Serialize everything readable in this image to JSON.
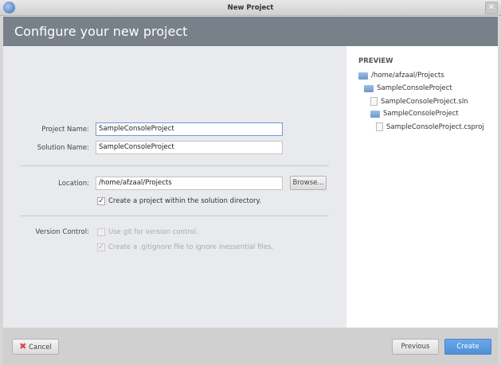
{
  "window": {
    "title": "New Project"
  },
  "header": {
    "title": "Configure your new project"
  },
  "form": {
    "project_name_label": "Project Name:",
    "project_name_value": "SampleConsoleProject",
    "solution_name_label": "Solution Name:",
    "solution_name_value": "SampleConsoleProject",
    "location_label": "Location:",
    "location_value": "/home/afzaal/Projects",
    "browse_label": "Browse...",
    "create_in_solution_dir_label": "Create a project within the solution directory.",
    "create_in_solution_dir_checked": true,
    "version_control_label": "Version Control:",
    "use_git_label": "Use git for version control.",
    "use_git_checked": false,
    "gitignore_label": "Create a .gitignore file to ignore inessential files.",
    "gitignore_checked": true
  },
  "preview": {
    "title": "PREVIEW",
    "items": [
      {
        "type": "folder",
        "label": "/home/afzaal/Projects",
        "depth": 0
      },
      {
        "type": "folder",
        "label": "SampleConsoleProject",
        "depth": 1
      },
      {
        "type": "file",
        "label": "SampleConsoleProject.sln",
        "depth": 2
      },
      {
        "type": "folder",
        "label": "SampleConsoleProject",
        "depth": 2
      },
      {
        "type": "file",
        "label": "SampleConsoleProject.csproj",
        "depth": 3
      }
    ]
  },
  "footer": {
    "cancel_label": "Cancel",
    "previous_label": "Previous",
    "create_label": "Create"
  },
  "colors": {
    "accent": "#5b9be0",
    "header_bg": "#78808a"
  }
}
